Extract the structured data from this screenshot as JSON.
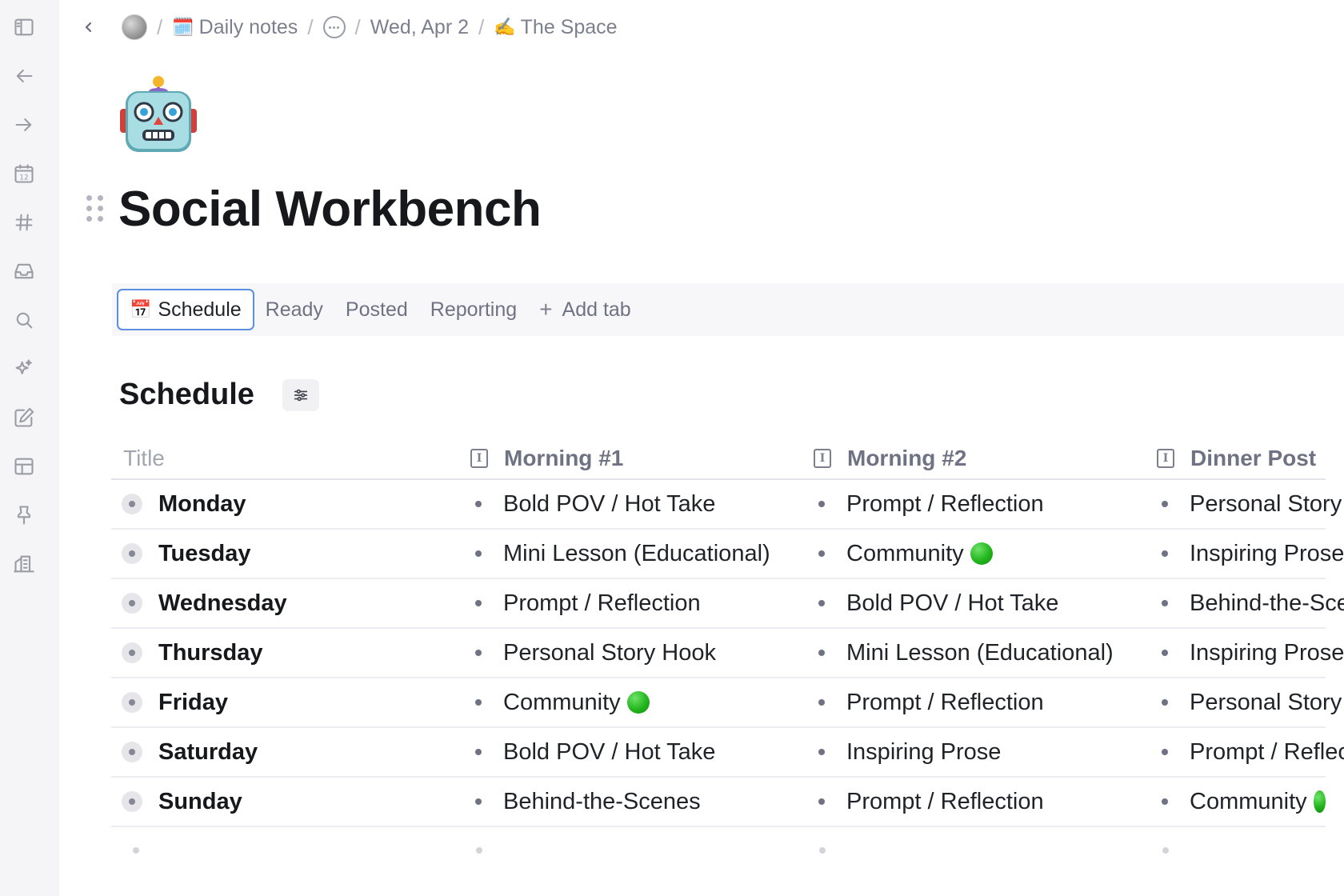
{
  "breadcrumb": {
    "daily_notes": "Daily notes",
    "daily_notes_icon": "🗓️",
    "date": "Wed, Apr 2",
    "space": "The Space",
    "space_icon": "✍️"
  },
  "page": {
    "icon": "robot-icon",
    "title": "Social Workbench"
  },
  "tabs": [
    {
      "label": "Schedule",
      "icon": "📅",
      "active": true
    },
    {
      "label": "Ready"
    },
    {
      "label": "Posted"
    },
    {
      "label": "Reporting"
    }
  ],
  "add_tab_label": "Add tab",
  "section": {
    "title": "Schedule"
  },
  "table": {
    "headers": [
      "Title",
      "Morning #1",
      "Morning #2",
      "Dinner Post"
    ],
    "rows": [
      {
        "day": "Monday",
        "m1": "Bold POV / Hot Take",
        "m2": "Prompt / Reflection",
        "dinner": "Personal Story Hook"
      },
      {
        "day": "Tuesday",
        "m1": "Mini Lesson (Educational)",
        "m2": "Community",
        "dinner": "Inspiring Prose"
      },
      {
        "day": "Wednesday",
        "m1": "Prompt / Reflection",
        "m2": "Bold POV / Hot Take",
        "dinner": "Behind-the-Scenes"
      },
      {
        "day": "Thursday",
        "m1": "Personal Story Hook",
        "m2": "Mini Lesson (Educational)",
        "dinner": "Inspiring Prose"
      },
      {
        "day": "Friday",
        "m1": "Community",
        "m2": "Prompt / Reflection",
        "dinner": "Personal Story Hook"
      },
      {
        "day": "Saturday",
        "m1": "Bold POV / Hot Take",
        "m2": "Inspiring Prose",
        "dinner": "Prompt / Reflection"
      },
      {
        "day": "Sunday",
        "m1": "Behind-the-Scenes",
        "m2": "Prompt / Reflection",
        "dinner": "Community"
      }
    ]
  },
  "colors": {
    "accent": "#5b8fe0",
    "community_dot": "#22b51d"
  }
}
